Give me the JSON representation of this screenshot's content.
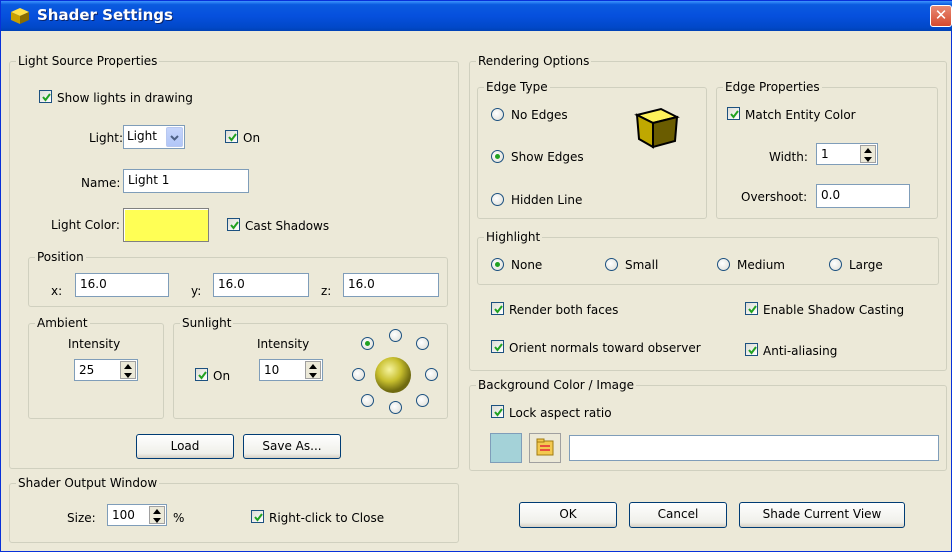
{
  "window": {
    "title": "Shader Settings",
    "close_glyph": "✕"
  },
  "light_source": {
    "legend": "Light Source Properties",
    "show_lights_label": "Show lights in drawing",
    "light_label": "Light:",
    "light_value": "Light",
    "on_label": "On",
    "name_label": "Name:",
    "name_value": "Light 1",
    "light_color_label": "Light Color:",
    "light_color": "#ffff55",
    "cast_shadows_label": "Cast Shadows",
    "position": {
      "legend": "Position",
      "x_label": "x:",
      "x_value": "16.0",
      "y_label": "y:",
      "y_value": "16.0",
      "z_label": "z:",
      "z_value": "16.0"
    },
    "ambient": {
      "legend": "Ambient",
      "intensity_label": "Intensity",
      "intensity_value": "25"
    },
    "sunlight": {
      "legend": "Sunlight",
      "intensity_label": "Intensity",
      "on_label": "On",
      "intensity_value": "10"
    },
    "load_label": "Load",
    "save_as_label": "Save As..."
  },
  "shader_output": {
    "legend": "Shader Output Window",
    "size_label": "Size:",
    "size_value": "100",
    "percent": "%",
    "right_click_label": "Right-click to Close"
  },
  "rendering": {
    "legend": "Rendering Options",
    "edge_type": {
      "legend": "Edge Type",
      "no_edges": "No Edges",
      "show_edges": "Show Edges",
      "hidden_line": "Hidden Line",
      "selected": "Show Edges"
    },
    "edge_props": {
      "legend": "Edge Properties",
      "match_entity": "Match Entity Color",
      "width_label": "Width:",
      "width_value": "1",
      "overshoot_label": "Overshoot:",
      "overshoot_value": "0.0"
    },
    "highlight": {
      "legend": "Highlight",
      "none": "None",
      "small": "Small",
      "medium": "Medium",
      "large": "Large",
      "selected": "None"
    },
    "render_both": "Render both faces",
    "enable_shadow": "Enable Shadow Casting",
    "orient_normals": "Orient normals toward observer",
    "anti_aliasing": "Anti-aliasing"
  },
  "background": {
    "legend": "Background Color / Image",
    "lock_aspect": "Lock aspect ratio",
    "swatch_color": "#a4d2d8",
    "path_value": ""
  },
  "buttons": {
    "ok": "OK",
    "cancel": "Cancel",
    "shade_current": "Shade Current View"
  },
  "colors": {
    "title_bar": "#0a5bdf",
    "dialog_bg": "#ece9d8",
    "check_green": "#21a121"
  }
}
